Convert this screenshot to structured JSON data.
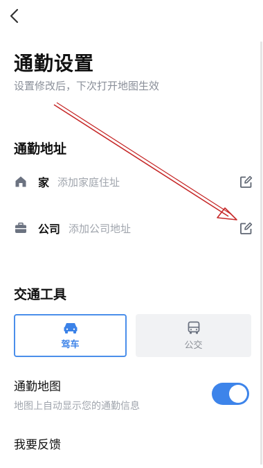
{
  "header": {
    "title": "通勤设置",
    "subtitle": "设置修改后，下次打开地图生效"
  },
  "address_section": {
    "title": "通勤地址",
    "items": [
      {
        "label": "家",
        "placeholder": "添加家庭住址",
        "icon": "home-icon"
      },
      {
        "label": "公司",
        "placeholder": "添加公司地址",
        "icon": "briefcase-icon"
      }
    ]
  },
  "transport_section": {
    "title": "交通工具",
    "options": [
      {
        "label": "驾车",
        "icon": "car-icon",
        "selected": true
      },
      {
        "label": "公交",
        "icon": "bus-icon",
        "selected": false
      }
    ]
  },
  "commute_map": {
    "title": "通勤地图",
    "description": "地图上自动显示您的通勤信息",
    "enabled": true
  },
  "feedback": {
    "label": "我要反馈"
  },
  "colors": {
    "accent": "#3d84ea",
    "arrow": "#c62828"
  }
}
